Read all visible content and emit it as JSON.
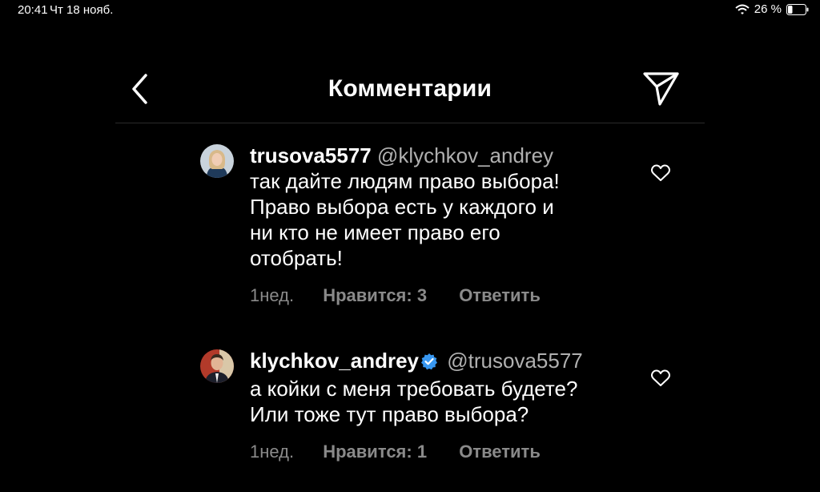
{
  "status_bar": {
    "time": "20:41",
    "date": "Чт 18 нояб.",
    "battery": "26 %",
    "battery_level": 0.26
  },
  "header": {
    "title": "Комментарии",
    "back_icon": "chevron-left-icon",
    "share_icon": "paper-plane-icon"
  },
  "comments": [
    {
      "username": "trusova5577",
      "verified": false,
      "mention": "@klychkov_andrey",
      "text_lines": [
        "так дайте людям право выбора!",
        "Право выбора есть у каждого и",
        "ни кто не имеет право его",
        "отобрать!"
      ],
      "time": "1нед.",
      "likes": "Нравится: 3",
      "reply": "Ответить"
    },
    {
      "username": "klychkov_andrey",
      "verified": true,
      "mention": "@trusova5577",
      "text_lines": [
        "а койки с меня требовать будете?",
        "Или тоже тут право выбора?"
      ],
      "time": "1нед.",
      "likes": "Нравится: 1",
      "reply": "Ответить"
    }
  ],
  "colors": {
    "background": "#000000",
    "text": "#ffffff",
    "secondary": "#8a8a8a",
    "verified": "#3897f0"
  }
}
